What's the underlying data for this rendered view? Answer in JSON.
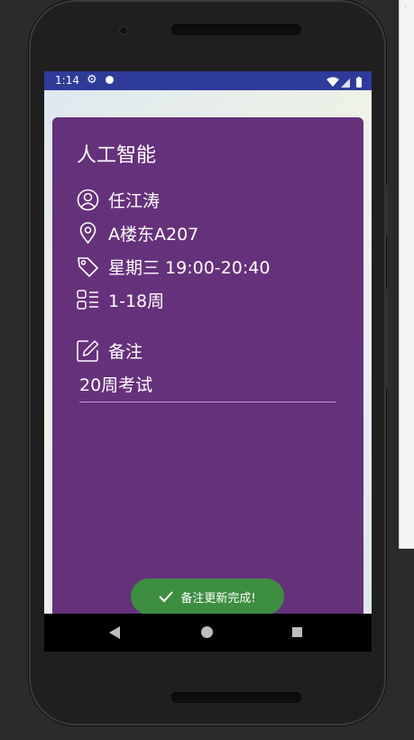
{
  "status_bar": {
    "time": "1:14"
  },
  "course": {
    "name": "人工智能",
    "teacher": "任江涛",
    "location": "A楼东A207",
    "schedule": "星期三 19:00-20:40",
    "weeks": "1-18周"
  },
  "note": {
    "label": "备注",
    "value": "20周考试"
  },
  "toast": {
    "message": "备注更新完成!"
  },
  "colors": {
    "card": "#66317b",
    "status_bar": "#2e3b99",
    "toast": "#3e8e41"
  },
  "icons": [
    "person-icon",
    "location-pin-icon",
    "tag-icon",
    "list-icon",
    "edit-note-icon",
    "check-icon",
    "gear-icon",
    "wifi-icon",
    "signal-icon",
    "battery-icon",
    "nav-back-icon",
    "nav-home-icon",
    "nav-recent-icon"
  ]
}
